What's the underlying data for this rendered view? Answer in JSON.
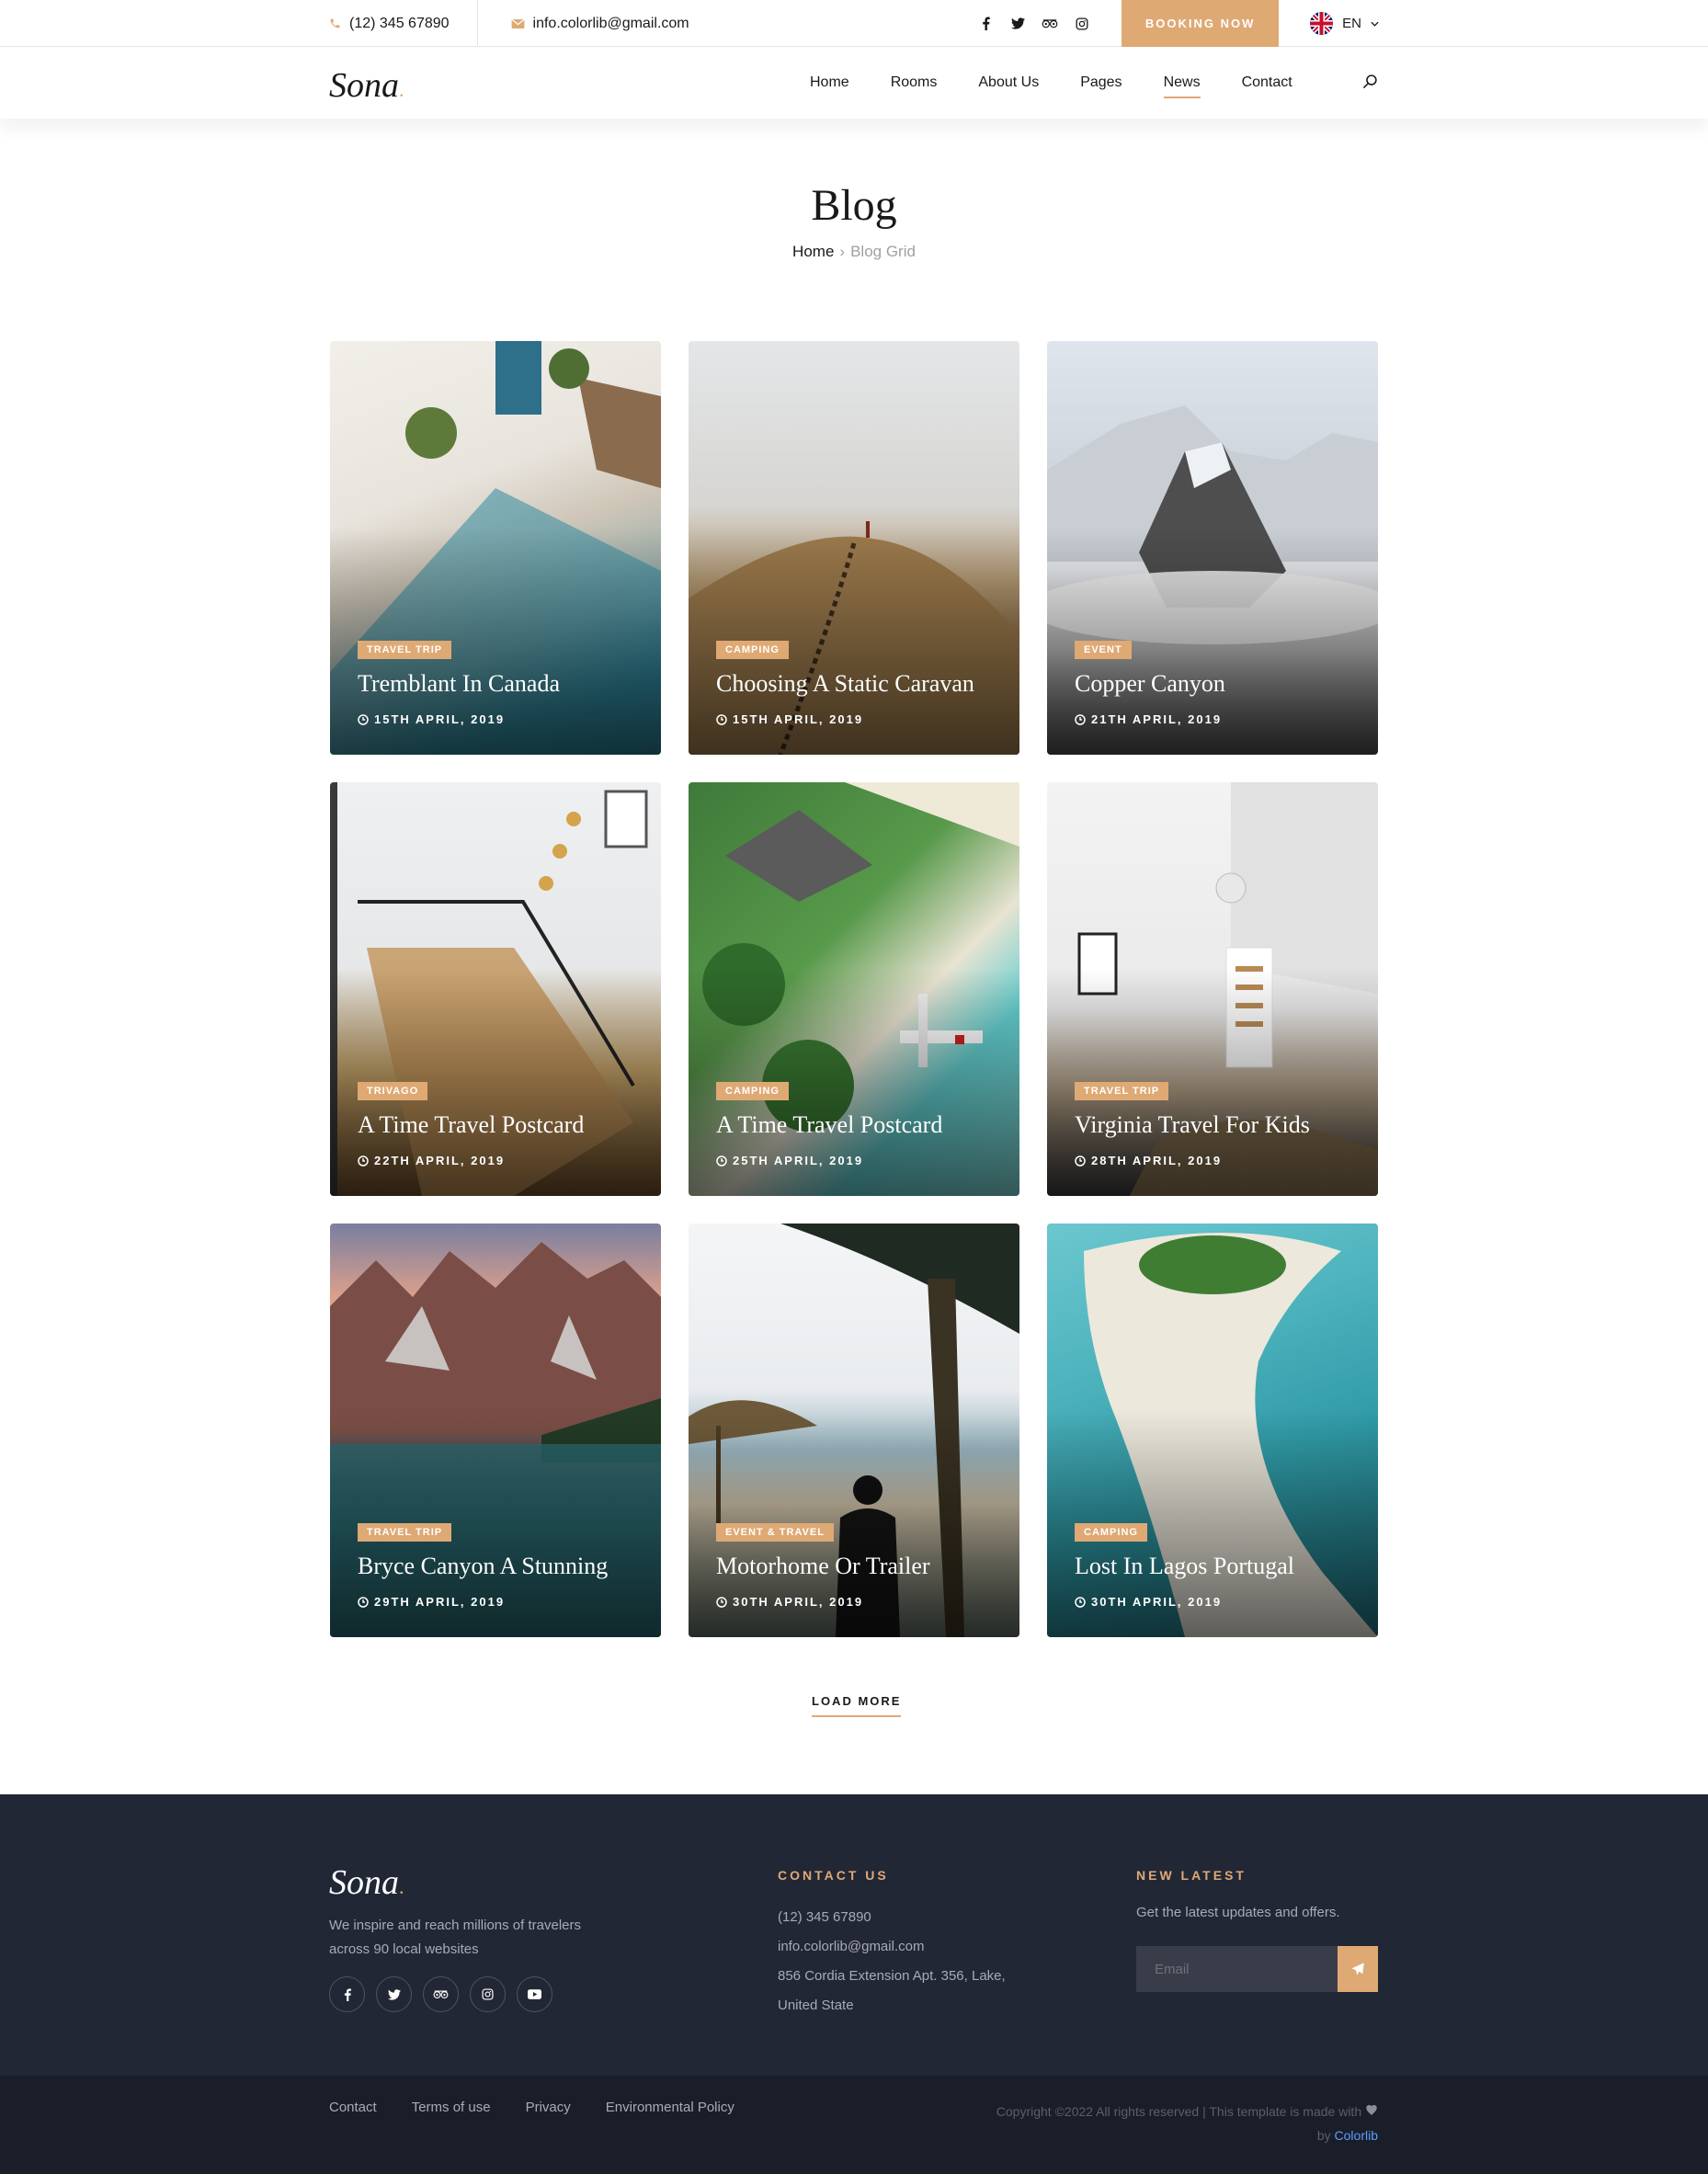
{
  "topbar": {
    "phone": "(12) 345 67890",
    "email": "info.colorlib@gmail.com",
    "social_icons": [
      "facebook-icon",
      "twitter-icon",
      "tripadvisor-icon",
      "instagram-icon"
    ],
    "booking_label": "BOOKING NOW",
    "language": "EN"
  },
  "header": {
    "logo": "Sona",
    "nav": [
      {
        "label": "Home",
        "active": false
      },
      {
        "label": "Rooms",
        "active": false
      },
      {
        "label": "About Us",
        "active": false
      },
      {
        "label": "Pages",
        "active": false
      },
      {
        "label": "News",
        "active": true
      },
      {
        "label": "Contact",
        "active": false
      }
    ]
  },
  "page": {
    "title": "Blog",
    "breadcrumb_home": "Home",
    "breadcrumb_current": "Blog Grid"
  },
  "posts": [
    {
      "tag": "TRAVEL TRIP",
      "title": "Tremblant In Canada",
      "date": "15TH APRIL, 2019"
    },
    {
      "tag": "CAMPING",
      "title": "Choosing A Static Caravan",
      "date": "15TH APRIL, 2019"
    },
    {
      "tag": "EVENT",
      "title": "Copper Canyon",
      "date": "21TH APRIL, 2019"
    },
    {
      "tag": "TRIVAGO",
      "title": "A Time Travel Postcard",
      "date": "22TH APRIL, 2019"
    },
    {
      "tag": "CAMPING",
      "title": "A Time Travel Postcard",
      "date": "25TH APRIL, 2019"
    },
    {
      "tag": "TRAVEL TRIP",
      "title": "Virginia Travel For Kids",
      "date": "28TH APRIL, 2019"
    },
    {
      "tag": "TRAVEL TRIP",
      "title": "Bryce Canyon A Stunning",
      "date": "29TH APRIL, 2019"
    },
    {
      "tag": "EVENT & TRAVEL",
      "title": "Motorhome Or Trailer",
      "date": "30TH APRIL, 2019"
    },
    {
      "tag": "CAMPING",
      "title": "Lost In Lagos Portugal",
      "date": "30TH APRIL, 2019"
    }
  ],
  "load_more": "LOAD MORE",
  "footer": {
    "logo": "Sona",
    "description": "We inspire and reach millions of travelers across 90 local websites",
    "contact_heading": "CONTACT US",
    "contact_phone": "(12) 345 67890",
    "contact_email": "info.colorlib@gmail.com",
    "contact_address_1": "856 Cordia Extension Apt. 356, Lake,",
    "contact_address_2": "United State",
    "news_heading": "NEW LATEST",
    "news_text": "Get the latest updates and offers.",
    "email_placeholder": "Email",
    "links": [
      "Contact",
      "Terms of use",
      "Privacy",
      "Environmental Policy"
    ],
    "copyright": "Copyright ©2022 All rights reserved | This template is made with",
    "by": "by",
    "credit": "Colorlib"
  },
  "colors": {
    "accent": "#dfa974",
    "footer_bg": "#222736",
    "footer_bottom_bg": "#1a1e29"
  }
}
